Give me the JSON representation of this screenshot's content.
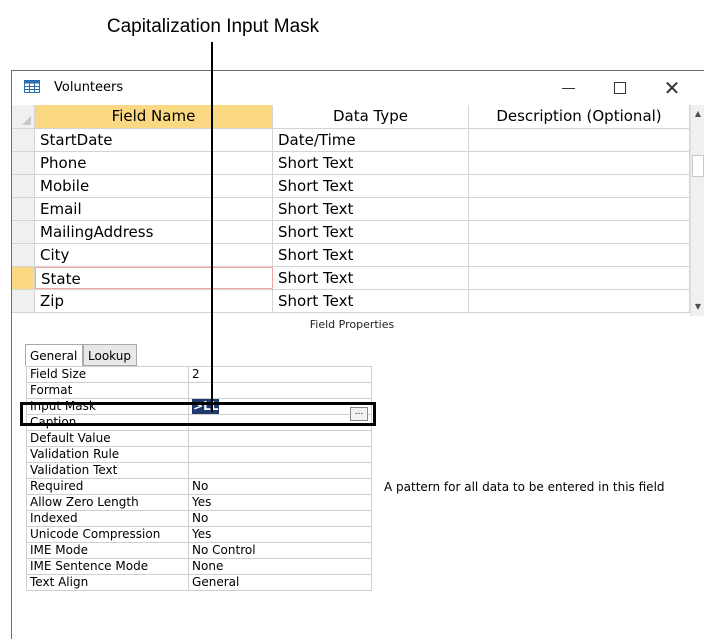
{
  "callout": {
    "label": "Capitalization Input Mask"
  },
  "window": {
    "title": "Volunteers",
    "controls": {
      "minimize": "–",
      "maximize": "□",
      "close": "✕"
    }
  },
  "table_design": {
    "headers": [
      "Field Name",
      "Data Type",
      "Description (Optional)"
    ],
    "rows": [
      {
        "field": "StartDate",
        "type": "Date/Time",
        "desc": ""
      },
      {
        "field": "Phone",
        "type": "Short Text",
        "desc": ""
      },
      {
        "field": "Mobile",
        "type": "Short Text",
        "desc": ""
      },
      {
        "field": "Email",
        "type": "Short Text",
        "desc": ""
      },
      {
        "field": "MailingAddress",
        "type": "Short Text",
        "desc": ""
      },
      {
        "field": "City",
        "type": "Short Text",
        "desc": ""
      },
      {
        "field": "State",
        "type": "Short Text",
        "desc": ""
      },
      {
        "field": "Zip",
        "type": "Short Text",
        "desc": ""
      }
    ],
    "selected_row": 6
  },
  "field_properties": {
    "title": "Field Properties",
    "tabs": [
      "General",
      "Lookup"
    ],
    "active_tab": "General",
    "rows": [
      {
        "name": "Field Size",
        "value": "2"
      },
      {
        "name": "Format",
        "value": ""
      },
      {
        "name": "Input Mask",
        "value": ">LL"
      },
      {
        "name": "Caption",
        "value": ""
      },
      {
        "name": "Default Value",
        "value": ""
      },
      {
        "name": "Validation Rule",
        "value": ""
      },
      {
        "name": "Validation Text",
        "value": ""
      },
      {
        "name": "Required",
        "value": "No"
      },
      {
        "name": "Allow Zero Length",
        "value": "Yes"
      },
      {
        "name": "Indexed",
        "value": "No"
      },
      {
        "name": "Unicode Compression",
        "value": "Yes"
      },
      {
        "name": "IME Mode",
        "value": "No Control"
      },
      {
        "name": "IME Sentence Mode",
        "value": "None"
      },
      {
        "name": "Text Align",
        "value": "General"
      }
    ],
    "build_button": "...",
    "hint": "A pattern for all data to be entered in this field"
  }
}
